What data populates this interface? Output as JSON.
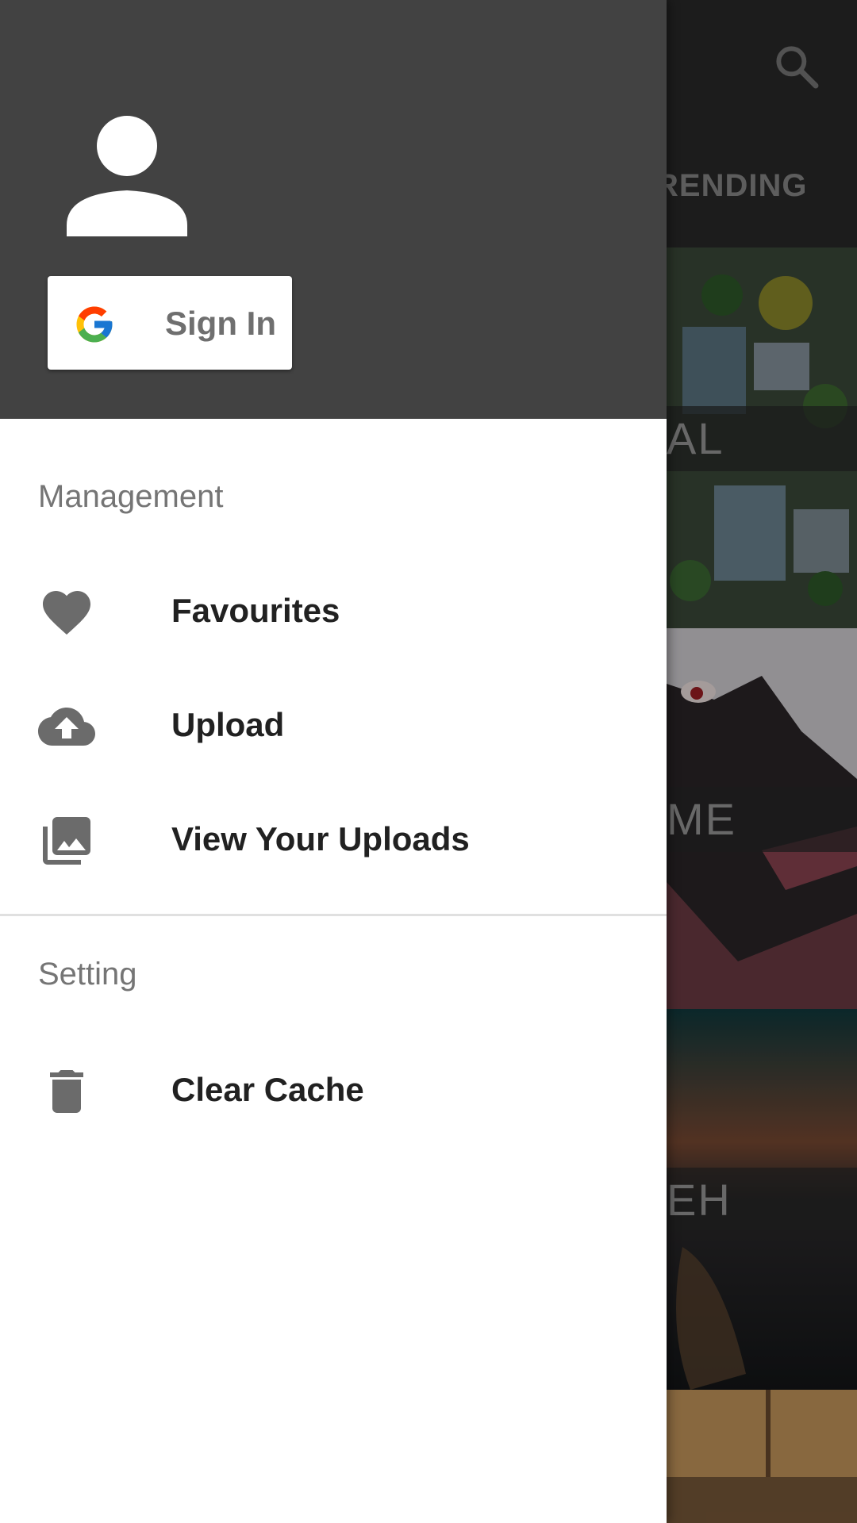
{
  "background": {
    "tab_partial": "RENDING",
    "cards": [
      {
        "label": "AL"
      },
      {
        "label": "ME"
      },
      {
        "label": "EH"
      }
    ]
  },
  "drawer": {
    "signin_label": "Sign In",
    "sections": {
      "management": {
        "title": "Management",
        "items": [
          {
            "label": "Favourites",
            "icon": "heart-icon"
          },
          {
            "label": "Upload",
            "icon": "cloud-upload-icon"
          },
          {
            "label": "View Your Uploads",
            "icon": "photo-library-icon"
          }
        ]
      },
      "setting": {
        "title": "Setting",
        "items": [
          {
            "label": "Clear Cache",
            "icon": "trash-icon"
          }
        ]
      }
    }
  },
  "colors": {
    "header_bg": "#424242",
    "icon_gray": "#6b6b6b",
    "text_primary": "#212121",
    "section_gray": "#757575"
  }
}
